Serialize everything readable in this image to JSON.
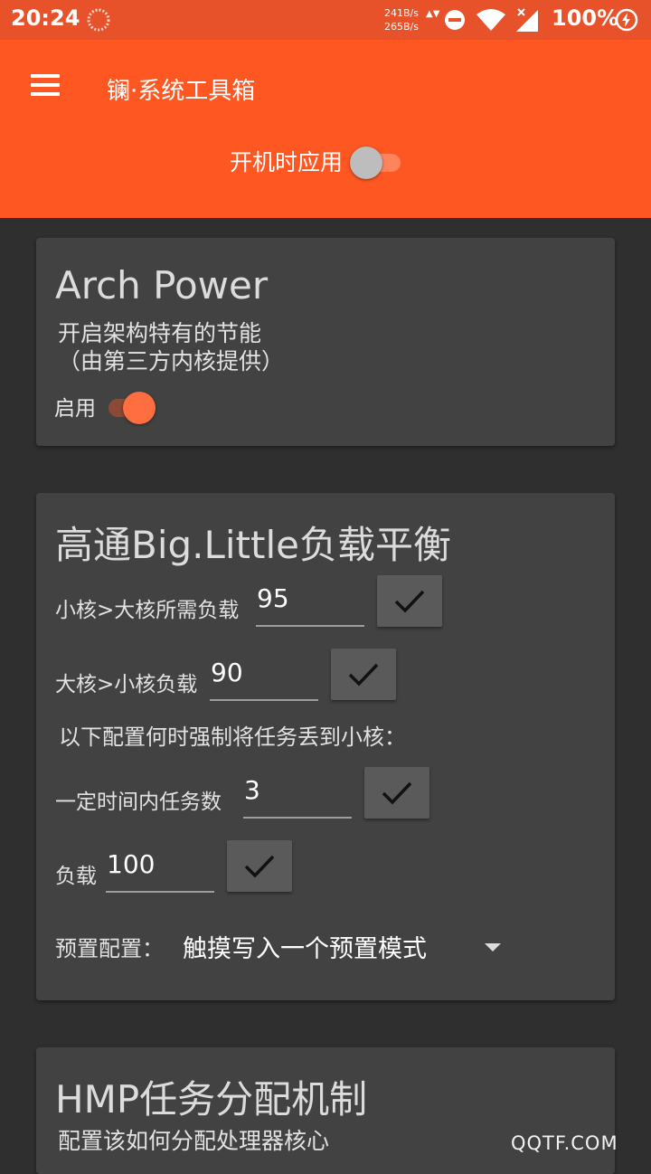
{
  "status_bar": {
    "time": "20:24",
    "net_up": "241B/s",
    "net_down": "265B/s",
    "arrows": "▲▼",
    "battery": "100%",
    "icons": [
      "notification-icon",
      "dnd-icon",
      "wifi-icon",
      "signal-icon",
      "charging-icon"
    ]
  },
  "app_bar": {
    "title": "镧·系统工具箱",
    "boot_label": "开机时应用",
    "boot_enabled": false
  },
  "arch_power": {
    "title": "Arch Power",
    "desc": "开启架构特有的节能\n（由第三方内核提供）",
    "enable_label": "启用",
    "enabled": true
  },
  "big_little": {
    "title": "高通Big.Little负载平衡",
    "up_label": "小核>大核所需负载",
    "up_value": "95",
    "down_label": "大核>小核负载",
    "down_value": "90",
    "note": "以下配置何时强制将任务丢到小核：",
    "tasks_label": "一定时间内任务数",
    "tasks_value": "3",
    "load_label": "负载",
    "load_value": "100",
    "preset_label": "预置配置：",
    "preset_value": "触摸写入一个预置模式"
  },
  "hmp": {
    "title": "HMP任务分配机制",
    "desc": "配置该如何分配处理器核心"
  },
  "watermark": "QQTF.COM",
  "colors": {
    "status_bar": "#e8522a",
    "app_bar": "#fe5722",
    "background": "#2f2f2f",
    "card": "#424242",
    "accent": "#ff6e40"
  }
}
